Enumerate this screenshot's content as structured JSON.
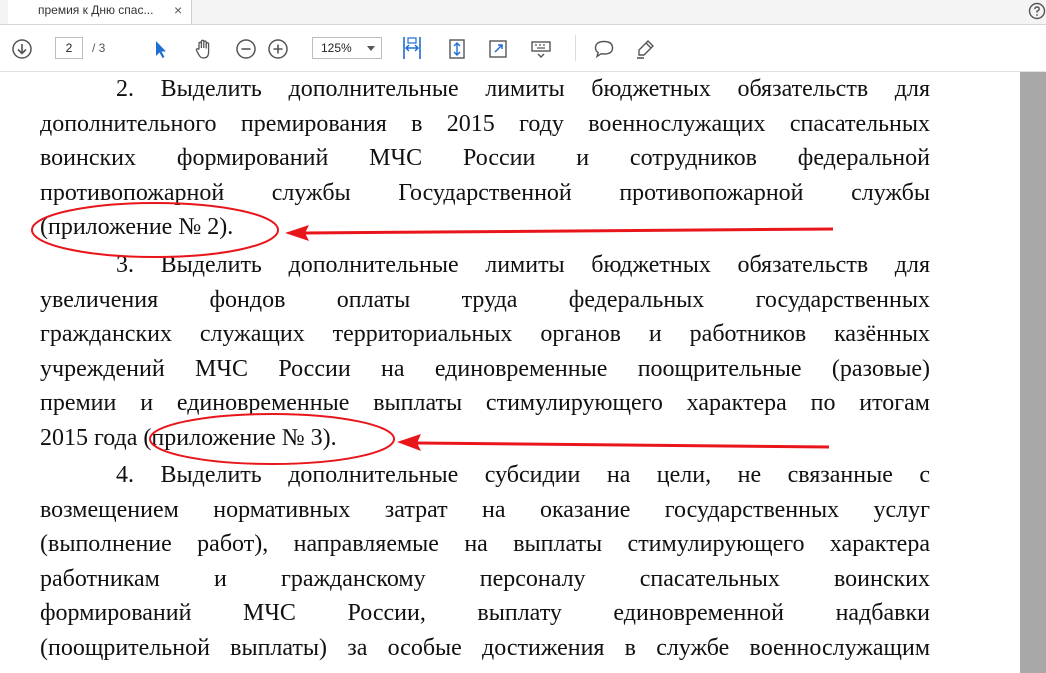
{
  "tab": {
    "title": "премия к Дню спас...",
    "close": "×"
  },
  "toolbar": {
    "page_current": "2",
    "page_total": "/ 3",
    "zoom": "125%"
  },
  "document": {
    "p2": [
      "2. Выделить дополнительные лимиты бюджетных обязательств для",
      "дополнительного премирования в 2015 году военнослужащих спасательных",
      "воинских формирований МЧС России и сотрудников федеральной",
      "противопожарной службы Государственной противопожарной службы",
      "(приложение № 2)."
    ],
    "p3": [
      "3. Выделить дополнительные лимиты бюджетных обязательств для",
      "увеличения фондов оплаты труда федеральных государственных",
      "гражданских служащих территориальных органов и работников казённых",
      "учреждений МЧС России на единовременные поощрительные (разовые)",
      "премии и единовременные выплаты стимулирующего характера по итогам",
      "2015 года (приложение № 3)."
    ],
    "p4": [
      "4. Выделить дополнительные субсидии на цели, не связанные с",
      "возмещением нормативных затрат на оказание государственных услуг",
      "(выполнение работ), направляемые на выплаты стимулирующего характера",
      "работникам и гражданскому персоналу спасательных воинских",
      "формирований МЧС России, выплату единовременной надбавки",
      "(поощрительной выплаты) за особые достижения в службе военнослужащим"
    ]
  },
  "annotations": {
    "color": "#e8161b",
    "marks": [
      "ellipse-around-appendix-2",
      "arrow-to-appendix-2",
      "ellipse-around-appendix-3",
      "arrow-to-appendix-3"
    ]
  },
  "icons": [
    "help-icon",
    "download-icon",
    "select-icon",
    "hand-icon",
    "zoom-out-icon",
    "zoom-in-icon",
    "fit-width-icon",
    "fit-page-icon",
    "fullscreen-icon",
    "keyboard-icon",
    "comment-icon",
    "highlight-icon"
  ]
}
